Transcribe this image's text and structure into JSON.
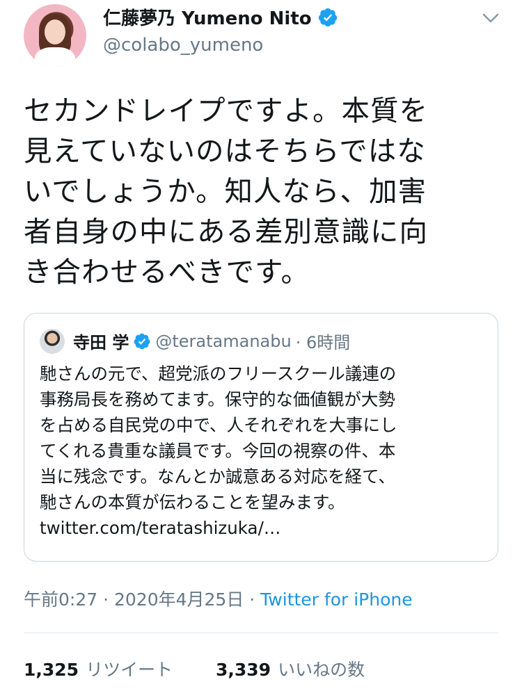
{
  "author": {
    "name": "仁藤夢乃 Yumeno Nito",
    "handle": "@colabo_yumeno"
  },
  "tweet": {
    "lines": [
      "セカンドレイプですよ。本質を",
      "見えていないのはそちらではな",
      "いでしょうか。知人なら、加害",
      "者自身の中にある差別意識に向",
      "き合わせるべきです。"
    ]
  },
  "quote": {
    "name": "寺田 学",
    "handle": "@teratamanabu",
    "time": "· 6時間",
    "lines": [
      "馳さんの元で、超党派のフリースクール議連の",
      "事務局長を務めてます。保守的な価値観が大勢",
      "を占める自民党の中で、人それぞれを大事にし",
      "てくれる貴重な議員です。今回の視察の件、本",
      "当に残念です。なんとか誠意ある対応を経て、",
      "馳さんの本質が伝わることを望みます。",
      "twitter.com/teratashizuka/…"
    ]
  },
  "meta": {
    "timestamp": "午前0:27 · 2020年4月25日 · ",
    "source": "Twitter for iPhone"
  },
  "stats": {
    "retweets": "1,325",
    "retweets_label": "リツイート",
    "likes": "3,339",
    "likes_label": "いいねの数"
  },
  "icons": {
    "verified": "verified-badge-icon",
    "menu": "chevron-down-icon"
  },
  "colors": {
    "accent": "#1b95e0",
    "secondary_text": "#657786",
    "border": "#ccd6dd"
  }
}
